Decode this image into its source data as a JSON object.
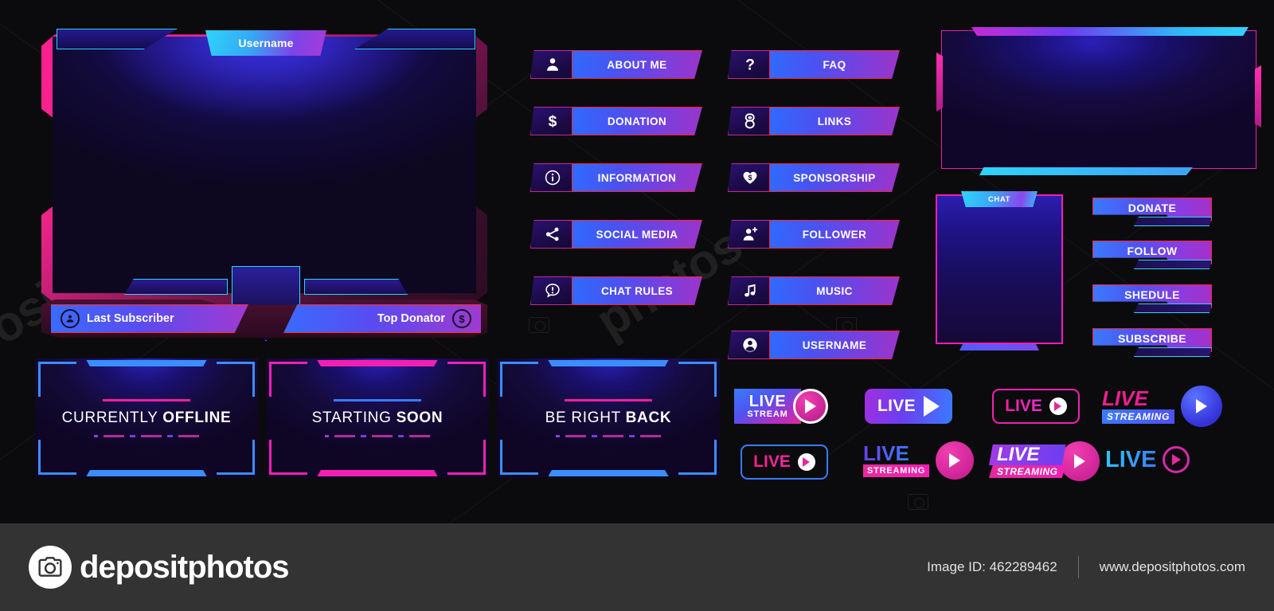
{
  "webcam": {
    "tab_label": "Username",
    "left_pill": "Last Subscriber",
    "right_pill": "Top Donator",
    "left_icon": "user-icon",
    "right_icon": "dollar-icon"
  },
  "menu_column_1": [
    {
      "label": "ABOUT ME",
      "icon": "user-icon"
    },
    {
      "label": "DONATION",
      "icon": "dollar-icon"
    },
    {
      "label": "INFORMATION",
      "icon": "info-icon"
    },
    {
      "label": "SOCIAL MEDIA",
      "icon": "share-icon"
    },
    {
      "label": "CHAT RULES",
      "icon": "alert-chat-icon"
    }
  ],
  "menu_column_2": [
    {
      "label": "FAQ",
      "icon": "question-icon"
    },
    {
      "label": "LINKS",
      "icon": "link-icon"
    },
    {
      "label": "SPONSORSHIP",
      "icon": "heart-dollar-icon"
    },
    {
      "label": "FOLLOWER",
      "icon": "user-plus-icon"
    },
    {
      "label": "MUSIC",
      "icon": "music-note-icon"
    },
    {
      "label": "USERNAME",
      "icon": "user-circle-icon"
    }
  ],
  "chat_panel": {
    "tab_label": "CHAT"
  },
  "action_buttons": [
    {
      "label": "DONATE"
    },
    {
      "label": "FOLLOW"
    },
    {
      "label": "SHEDULE"
    },
    {
      "label": "SUBSCRIBE"
    }
  ],
  "screens": [
    {
      "light": "CURRENTLY",
      "bold": "OFFLINE",
      "accent": "#3a8eff",
      "rule": "#f41f9a"
    },
    {
      "light": "STARTING",
      "bold": "SOON",
      "accent": "#f41fb2",
      "rule": "#3a7bff"
    },
    {
      "light": "BE RIGHT",
      "bold": "BACK",
      "accent": "#3a8eff",
      "rule": "#f41f9a"
    }
  ],
  "live_badges": [
    {
      "id": "live-stream-badge",
      "line1": "LIVE",
      "line2": "STREAM"
    },
    {
      "id": "live-pill-badge",
      "line1": "LIVE",
      "line2": ""
    },
    {
      "id": "live-outline-pink-badge",
      "line1": "LIVE",
      "line2": ""
    },
    {
      "id": "live-streaming-italic-badge",
      "line1": "LIVE",
      "line2": "STREAMING"
    },
    {
      "id": "live-outline-blue-badge",
      "line1": "LIVE",
      "line2": ""
    },
    {
      "id": "live-streaming-block-badge",
      "line1": "LIVE",
      "line2": "STREAMING"
    },
    {
      "id": "live-streaming-slant-badge",
      "line1": "LIVE",
      "line2": "STREAMING"
    },
    {
      "id": "live-ring-badge",
      "line1": "LIVE",
      "line2": ""
    }
  ],
  "footer": {
    "brand": "depositphotos",
    "image_id_label": "Image ID: 462289462",
    "website": "www.depositphotos.com",
    "camera_icon": "camera-icon"
  },
  "colors": {
    "background": "#0b0b0d",
    "pink": "#f41fb2",
    "magenta": "#ff1f8f",
    "cyan": "#2fd3fb",
    "blue": "#3a7bff",
    "purple": "#8a3ce0",
    "red_edge": "#ff1f33",
    "footer_bg": "#333333"
  }
}
